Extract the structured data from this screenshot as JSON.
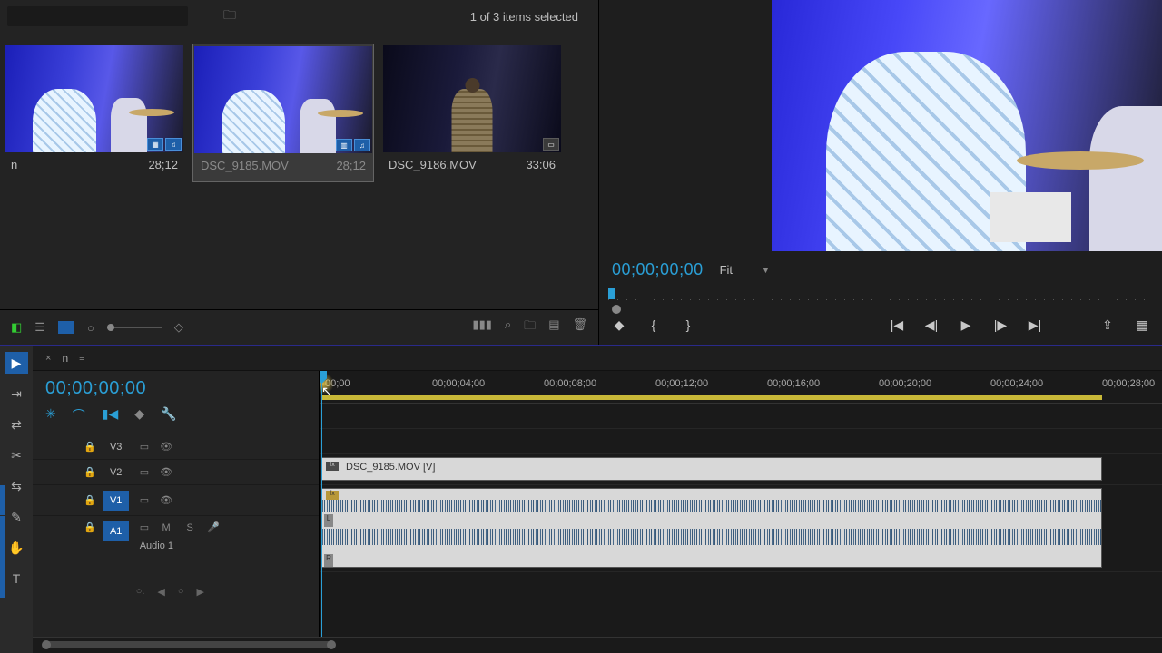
{
  "project": {
    "search_placeholder": "",
    "selection_text": "1 of 3 items selected",
    "clips": [
      {
        "name": "n",
        "duration": "28;12",
        "selected": false,
        "type": "seq"
      },
      {
        "name": "DSC_9185.MOV",
        "duration": "28;12",
        "selected": true,
        "type": "vid"
      },
      {
        "name": "DSC_9186.MOV",
        "duration": "33:06",
        "selected": false,
        "type": "vid2"
      }
    ]
  },
  "program": {
    "timecode": "00;00;00;00",
    "fit_label": "Fit"
  },
  "timeline": {
    "sequence_name": "n",
    "timecode": "00;00;00;00",
    "ruler_labels": [
      "00;00",
      "00;00;04;00",
      "00;00;08;00",
      "00;00;12;00",
      "00;00;16;00",
      "00;00;20;00",
      "00;00;24;00",
      "00;00;28;00"
    ],
    "tracks": {
      "v3": "V3",
      "v2": "V2",
      "v1": "V1",
      "a1": "A1",
      "audio1_name": "Audio 1",
      "m": "M",
      "s": "S"
    },
    "clip_on_v1": "DSC_9185.MOV [V]"
  }
}
